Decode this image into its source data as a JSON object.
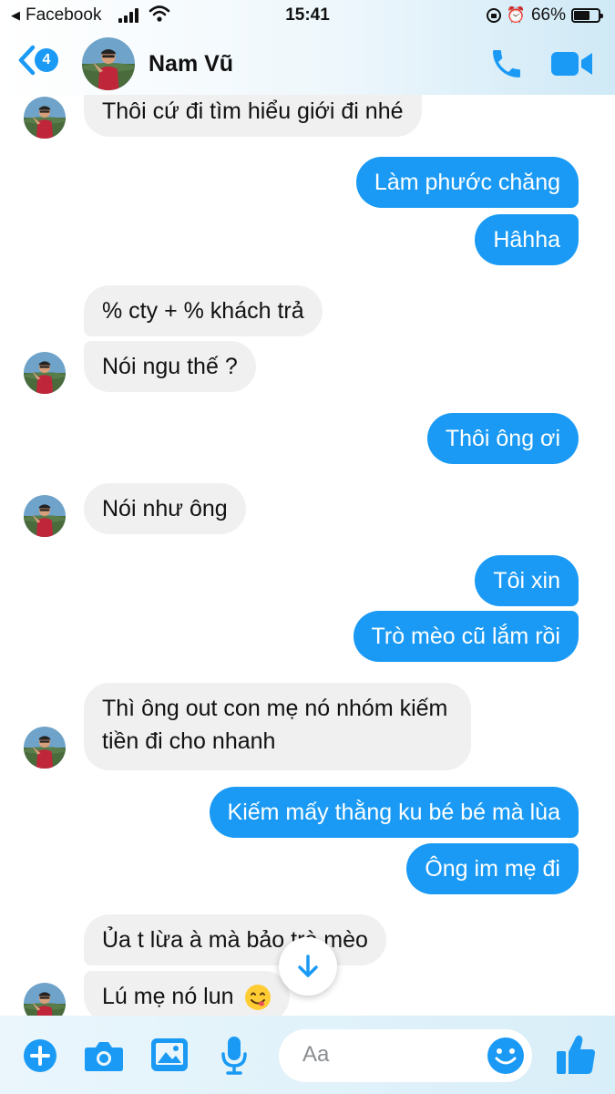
{
  "status_bar": {
    "back_app": "Facebook",
    "time": "15:41",
    "battery": "66%",
    "battery_level": 0.66
  },
  "header": {
    "unread_count": "4",
    "contact_name": "Nam Vũ",
    "icons": [
      "back-chevron-icon",
      "phone-icon",
      "video-camera-icon"
    ]
  },
  "messages": [
    {
      "direction": "in",
      "text": "Thôi cứ đi tìm hiểu giới đi nhé"
    },
    {
      "direction": "out",
      "text": "Làm phước chăng"
    },
    {
      "direction": "out",
      "text": "Hâhha"
    },
    {
      "direction": "in",
      "text": "% cty + % khách trả"
    },
    {
      "direction": "in",
      "text": "Nói ngu thế ?"
    },
    {
      "direction": "out",
      "text": "Thôi ông ơi"
    },
    {
      "direction": "in",
      "text": "Nói như ông"
    },
    {
      "direction": "out",
      "text": "Tôi xin"
    },
    {
      "direction": "out",
      "text": "Trò mèo cũ lắm rồi"
    },
    {
      "direction": "in",
      "text_line1": "Thì ông out con mẹ nó nhóm kiếm",
      "text_line2": "tiền đi cho nhanh"
    },
    {
      "direction": "out",
      "text": "Kiếm mấy thằng ku bé bé mà lùa"
    },
    {
      "direction": "out",
      "text": "Ông im mẹ đi"
    },
    {
      "direction": "in",
      "text": "Ủa t lừa à mà bảo trò mèo"
    },
    {
      "direction": "in",
      "text": "Lú mẹ nó lun",
      "emoji": "yum-face-emoji"
    }
  ],
  "composer": {
    "placeholder": "Aa",
    "icons": [
      "plus-icon",
      "camera-icon",
      "image-icon",
      "microphone-icon",
      "emoji-icon",
      "thumbs-up-icon"
    ]
  },
  "colors": {
    "accent": "#1a9af5",
    "incoming_bubble": "#f0f0f0",
    "outgoing_text": "#ffffff"
  }
}
